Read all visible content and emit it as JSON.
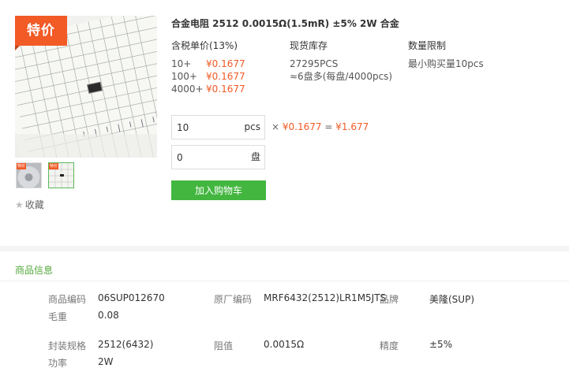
{
  "product": {
    "badge": "特价",
    "title": "合金电阻 2512 0.0015Ω(1.5mR) ±5% 2W 合金",
    "thumb_badge": "特价",
    "favorite_label": "收藏"
  },
  "pricing": {
    "header": "含税单价(13%)",
    "tiers": [
      {
        "qty": "10+",
        "price": "¥0.1677"
      },
      {
        "qty": "100+",
        "price": "¥0.1677"
      },
      {
        "qty": "4000+",
        "price": "¥0.1677"
      }
    ]
  },
  "stock": {
    "header": "现货库存",
    "count": "27295PCS",
    "reels": "≈6盘多(每盘/4000pcs)"
  },
  "limit": {
    "header": "数量限制",
    "text": "最小购买量10pcs"
  },
  "order": {
    "qty_value": "10",
    "qty_unit": "pcs",
    "reel_value": "0",
    "reel_unit": "盘",
    "multiply": "×",
    "unit_price": "¥0.1677",
    "equals": "=",
    "total": "¥1.677",
    "add_to_cart": "加入购物车"
  },
  "info": {
    "section_title": "商品信息",
    "product_code_label": "商品编码",
    "product_code": "06SUP012670",
    "mfr_code_label": "原厂编码",
    "mfr_code": "MRF6432(2512)LR1M5JTS",
    "brand_label": "品牌",
    "brand": "美隆(SUP)",
    "weight_label": "毛重",
    "weight": "0.08",
    "package_label": "封装规格",
    "package": "2512(6432)",
    "resistance_label": "阻值",
    "resistance": "0.0015Ω",
    "tolerance_label": "精度",
    "tolerance": "±5%",
    "power_label": "功率",
    "power": "2W"
  },
  "colors": {
    "accent_orange": "#f25a26",
    "cart_green": "#43b640",
    "section_green": "#52a83a"
  }
}
